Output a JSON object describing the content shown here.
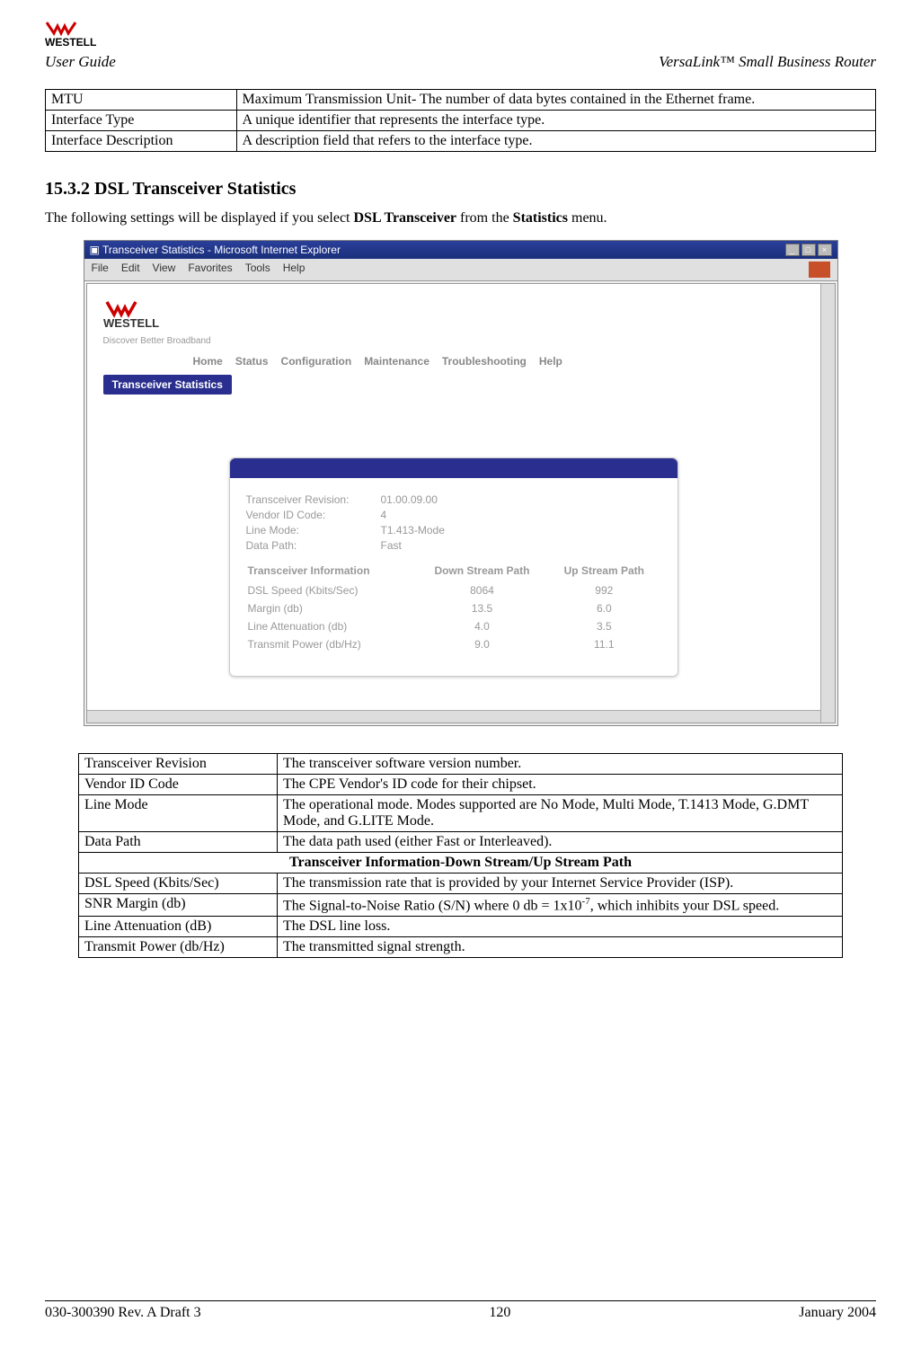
{
  "header": {
    "brand": "WESTELL",
    "user_guide": "User Guide",
    "product": "VersaLink™  Small Business Router"
  },
  "table1": [
    {
      "term": "MTU",
      "desc": "Maximum Transmission Unit- The number of data bytes contained in the Ethernet frame."
    },
    {
      "term": "Interface Type",
      "desc": "A unique identifier that represents the interface type."
    },
    {
      "term": "Interface Description",
      "desc": "A description field that refers to the interface type."
    }
  ],
  "section": {
    "number": "15.3.2",
    "title": "DSL Transceiver Statistics",
    "intro_prefix": "The following settings will be displayed if you select ",
    "intro_bold1": "DSL Transceiver",
    "intro_mid": " from the ",
    "intro_bold2": "Statistics",
    "intro_suffix": " menu."
  },
  "screenshot": {
    "window_title": "Transceiver Statistics - Microsoft Internet Explorer",
    "menus": [
      "File",
      "Edit",
      "View",
      "Favorites",
      "Tools",
      "Help"
    ],
    "brand": "WESTELL",
    "tagline": "Discover Better Broadband",
    "nav": [
      "Home",
      "Status",
      "Configuration",
      "Maintenance",
      "Troubleshooting",
      "Help"
    ],
    "subnav": "Transceiver Statistics",
    "info": {
      "rev_label": "Transceiver Revision:",
      "rev_value": "01.00.09.00",
      "vendor_label": "Vendor ID Code:",
      "vendor_value": "4",
      "mode_label": "Line Mode:",
      "mode_value": "T1.413-Mode",
      "path_label": "Data Path:",
      "path_value": "Fast"
    },
    "stats_headers": {
      "col1": "Transceiver Information",
      "col2": "Down Stream Path",
      "col3": "Up Stream Path"
    },
    "stats_rows": [
      {
        "label": "DSL Speed (Kbits/Sec)",
        "down": "8064",
        "up": "992"
      },
      {
        "label": "Margin (db)",
        "down": "13.5",
        "up": "6.0"
      },
      {
        "label": "Line Attenuation (db)",
        "down": "4.0",
        "up": "3.5"
      },
      {
        "label": "Transmit Power (db/Hz)",
        "down": "9.0",
        "up": "11.1"
      }
    ]
  },
  "table2": {
    "rows_top": [
      {
        "term": "Transceiver Revision",
        "desc": "The transceiver software version number."
      },
      {
        "term": "Vendor ID Code",
        "desc": "The CPE Vendor's ID code for their chipset."
      },
      {
        "term": "Line Mode",
        "desc": "The operational mode. Modes supported are No Mode, Multi Mode, T.1413 Mode, G.DMT Mode, and G.LITE Mode."
      },
      {
        "term": "Data Path",
        "desc": "The data path used (either Fast or Interleaved)."
      }
    ],
    "section_header": "Transceiver Information-Down Stream/Up Stream Path",
    "rows_bottom": [
      {
        "term": "DSL Speed (Kbits/Sec)",
        "desc": "The transmission rate that is provided by your Internet Service Provider (ISP)."
      },
      {
        "term": "SNR Margin (db)",
        "desc_pre": "The Signal-to-Noise Ratio (S/N) where 0 db = 1x10",
        "desc_sup": "-7",
        "desc_post": ", which inhibits your DSL speed."
      },
      {
        "term": "Line Attenuation (dB)",
        "desc": "The DSL line loss."
      },
      {
        "term": "Transmit Power (db/Hz)",
        "desc": "The transmitted signal strength."
      }
    ]
  },
  "footer": {
    "left": "030-300390 Rev. A Draft 3",
    "center": "120",
    "right": "January 2004"
  }
}
